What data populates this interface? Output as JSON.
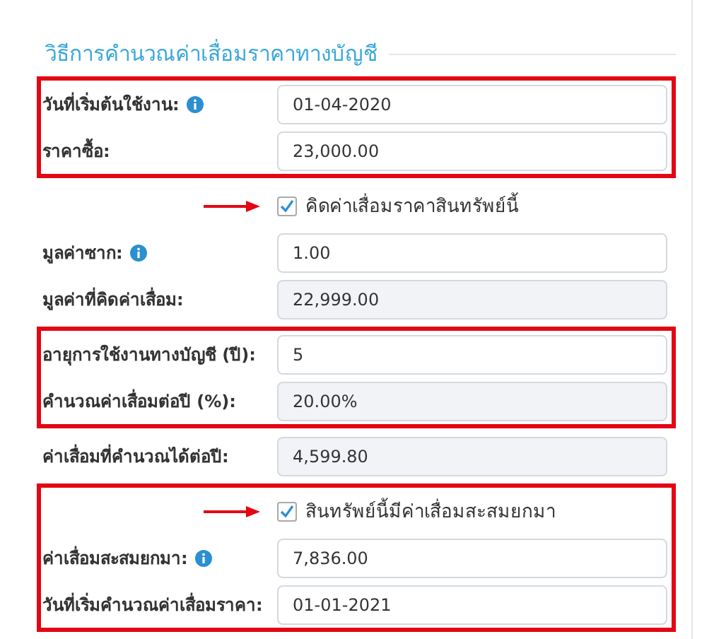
{
  "section_title": "วิธีการคำนวณค่าเสื่อมราคาทางบัญชี",
  "groups": [
    {
      "highlighted": true,
      "rows": [
        {
          "kind": "field",
          "label": "วันที่เริ่มต้นใช้งาน:",
          "info": true,
          "value": "01-04-2020",
          "readonly": false
        },
        {
          "kind": "field",
          "label": "ราคาซื้อ:",
          "info": false,
          "value": "23,000.00",
          "readonly": false
        }
      ]
    },
    {
      "highlighted": false,
      "rows": [
        {
          "kind": "checkbox",
          "label": "คิดค่าเสื่อมราคาสินทรัพย์นี้",
          "checked": true,
          "arrow": true
        },
        {
          "kind": "field",
          "label": "มูลค่าซาก:",
          "info": true,
          "value": "1.00",
          "readonly": false
        },
        {
          "kind": "field",
          "label": "มูลค่าที่คิดค่าเสื่อม:",
          "info": false,
          "value": "22,999.00",
          "readonly": true
        }
      ]
    },
    {
      "highlighted": true,
      "rows": [
        {
          "kind": "field",
          "label": "อายุการใช้งานทางบัญชี (ปี):",
          "info": false,
          "value": "5",
          "readonly": false
        },
        {
          "kind": "field",
          "label": "คำนวณค่าเสื่อมต่อปี (%):",
          "info": false,
          "value": "20.00%",
          "readonly": true
        }
      ]
    },
    {
      "highlighted": false,
      "rows": [
        {
          "kind": "field",
          "label": "ค่าเสื่อมที่คำนวณได้ต่อปี:",
          "info": false,
          "value": "4,599.80",
          "readonly": true
        }
      ]
    },
    {
      "highlighted": true,
      "rows": [
        {
          "kind": "checkbox",
          "label": "สินทรัพย์นี้มีค่าเสื่อมสะสมยกมา",
          "checked": true,
          "arrow": true
        },
        {
          "kind": "field",
          "label": "ค่าเสื่อมสะสมยกมา:",
          "info": true,
          "value": "7,836.00",
          "readonly": false
        },
        {
          "kind": "field",
          "label": "วันที่เริ่มคำนวณค่าเสื่อมราคา:",
          "info": false,
          "value": "01-01-2021",
          "readonly": false
        }
      ]
    }
  ]
}
